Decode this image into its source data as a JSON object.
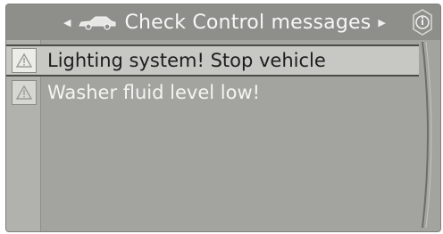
{
  "header": {
    "title": "Check Control messages",
    "left_arrow_icon": "arrow-left-icon",
    "right_arrow_icon": "arrow-right-icon",
    "car_icon": "car-icon",
    "info_icon": "info-icon"
  },
  "messages": [
    {
      "label": "Lighting system! Stop vehicle",
      "icon": "warning-triangle-icon",
      "selected": true
    },
    {
      "label": "Washer fluid level low!",
      "icon": "warning-triangle-icon",
      "selected": false
    }
  ],
  "colors": {
    "screen_bg": "#a3a4a0",
    "header_bg": "#8e8f8b",
    "selected_row_bg": "#c7c8c4",
    "text_light": "#f4f4f1",
    "text_dark": "#1d1e1b"
  }
}
